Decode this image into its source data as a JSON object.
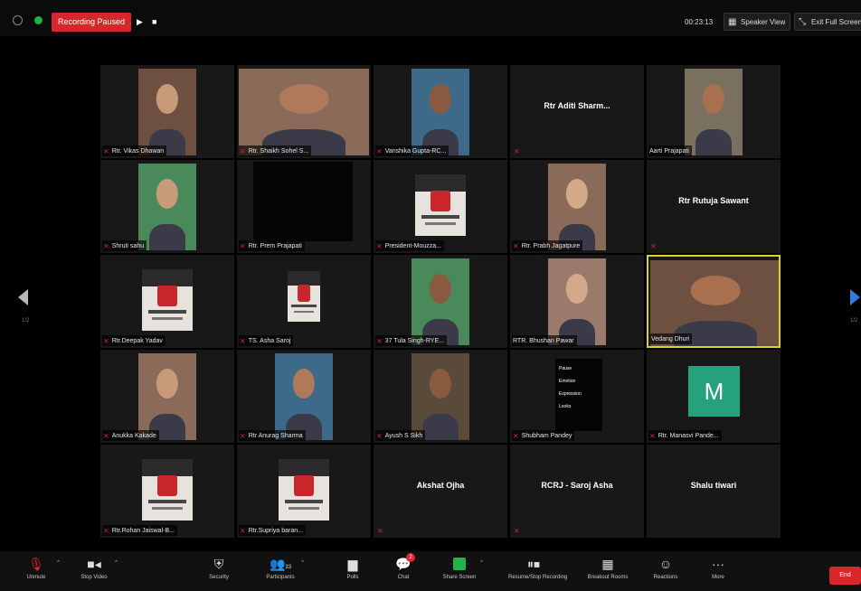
{
  "topbar": {
    "recording_label": "Recording Paused",
    "resume_glyph": "▶",
    "stop_glyph": "■",
    "timer": "00:23:13",
    "speaker_view": "Speaker View",
    "exit_full_screen": "Exit Full Screen"
  },
  "pager": {
    "left": "1/2",
    "right": "1/2"
  },
  "tiles": [
    {
      "name": "Rtr. Vikas Dhawan",
      "kind": "video",
      "muted": true
    },
    {
      "name": "Rtr. Shaikh Sohel S...",
      "kind": "video",
      "muted": true
    },
    {
      "name": "Vanshika Gupta-RC...",
      "kind": "video",
      "muted": true
    },
    {
      "name": "Rtr Aditi Sharm...",
      "kind": "name",
      "muted": true
    },
    {
      "name": "Aarti Prajapati",
      "kind": "video",
      "muted": false
    },
    {
      "name": "Shruti sahu",
      "kind": "video",
      "muted": true
    },
    {
      "name": "Rtr. Prem Prajapati",
      "kind": "black",
      "muted": true
    },
    {
      "name": "President-Mouzza...",
      "kind": "poster",
      "muted": true
    },
    {
      "name": "Rtr. Prabh Jagatpure",
      "kind": "video",
      "muted": true
    },
    {
      "name": "Rtr Rutuja Sawant",
      "kind": "name",
      "muted": true
    },
    {
      "name": "Rtr.Deepak Yadav",
      "kind": "poster",
      "muted": true
    },
    {
      "name": "TS. Asha Saroj",
      "kind": "poster-small",
      "muted": true
    },
    {
      "name": "37 Tula Singh-RYE...",
      "kind": "video",
      "muted": true
    },
    {
      "name": "RTR. Bhushan Pawar",
      "kind": "video",
      "muted": false
    },
    {
      "name": "Vedang Dhuri",
      "kind": "video",
      "muted": false,
      "active": true
    },
    {
      "name": "Anukka Kakade",
      "kind": "video",
      "muted": true
    },
    {
      "name": "Rtr Anurag Sharma",
      "kind": "video",
      "muted": true
    },
    {
      "name": "Ayush S Sikh",
      "kind": "video",
      "muted": true
    },
    {
      "name": "Shubham Pandey",
      "kind": "card",
      "muted": true
    },
    {
      "name": "Rtr. Manasvi Pande...",
      "kind": "avatar",
      "muted": true,
      "initial": "M"
    },
    {
      "name": "Rtr.Rohan Jaiswal-B...",
      "kind": "poster",
      "muted": true
    },
    {
      "name": "Rtr.Supriya baran...",
      "kind": "poster",
      "muted": true
    },
    {
      "name": "Akshat Ojha",
      "kind": "name",
      "muted": true
    },
    {
      "name": "RCRJ - Saroj Asha",
      "kind": "name",
      "muted": true
    },
    {
      "name": "Shalu tiwari",
      "kind": "name",
      "muted": false
    }
  ],
  "card_lines": [
    "Pause",
    "Emotion",
    "Expression",
    "Looks"
  ],
  "toolbar": {
    "unmute": "Unmute",
    "stop_video": "Stop Video",
    "security": "Security",
    "participants": "Participants",
    "participants_count": "33",
    "polls": "Polls",
    "chat": "Chat",
    "chat_badge": "2",
    "share_screen": "Share Screen",
    "recording": "Resume/Stop Recording",
    "breakout": "Breakout Rooms",
    "reactions": "Reactions",
    "more": "More",
    "more_glyph": "···",
    "end": "End"
  },
  "colors": {
    "accent_red": "#d8262b",
    "active_speaker": "#d8d22a",
    "share_green": "#23b14a",
    "avatar_green": "#25a17c",
    "nav_blue": "#2f7dd8"
  }
}
